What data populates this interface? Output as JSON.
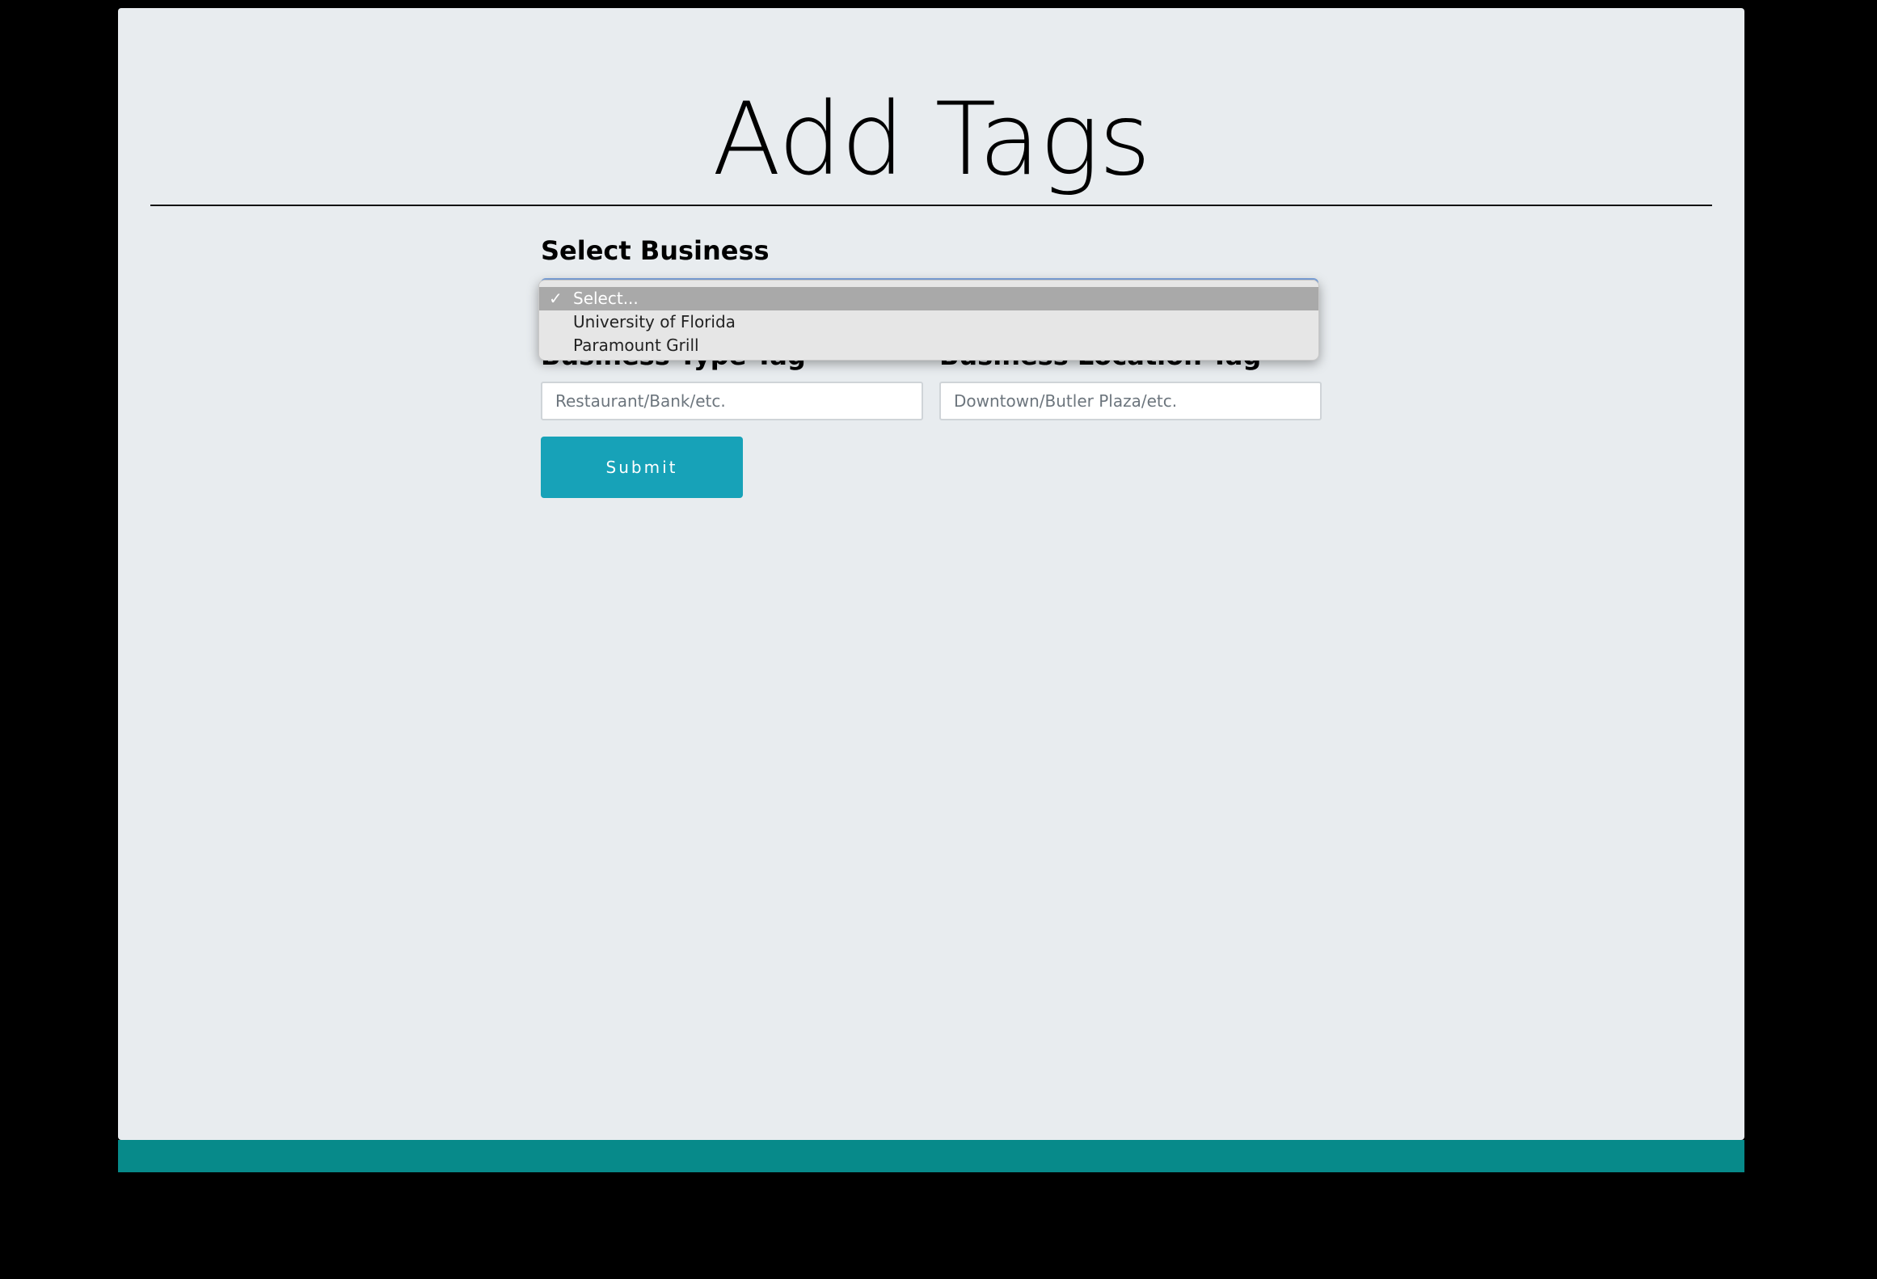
{
  "page": {
    "title": "Add Tags"
  },
  "form": {
    "select_business_label": "Select Business",
    "select_options": [
      {
        "label": "Select...",
        "selected": true
      },
      {
        "label": "University of Florida",
        "selected": false
      },
      {
        "label": "Paramount Grill",
        "selected": false
      }
    ],
    "business_type_label": "Business Type Tag",
    "business_type_placeholder": "Restaurant/Bank/etc.",
    "business_location_label": "Business Location Tag",
    "business_location_placeholder": "Downtown/Butler Plaza/etc.",
    "submit_label": "Submit"
  },
  "colors": {
    "background": "#e8ecef",
    "accent": "#17a2b8",
    "footer": "#078a8a"
  },
  "icons": {
    "selected_check": "✓"
  }
}
